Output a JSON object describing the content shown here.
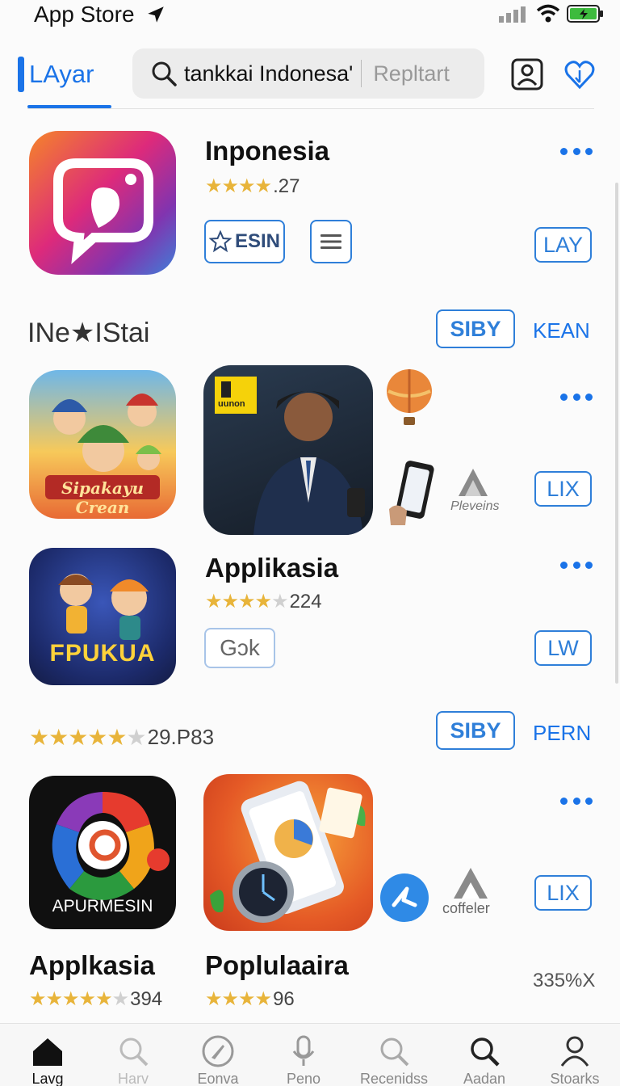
{
  "status_bar": {
    "title": "App Store"
  },
  "header": {
    "tab_label": "LAyar",
    "search_value": "tankkai Indonesa'",
    "search_action": "Repltart"
  },
  "featured": {
    "title": "Inponesia",
    "rating_value": ".27",
    "chip_label": "ESIN",
    "button": "LAY"
  },
  "section1": {
    "title": "INe★IStai",
    "button": "SIBY",
    "link": "KEAN"
  },
  "row1": {
    "game_tile_text": "Sipakayu Crean",
    "media_badge": "uunon",
    "side_logo": "Pleveins",
    "button": "LIX"
  },
  "app2": {
    "icon_text": "FPUKUA",
    "title": "Applikasia",
    "rating_value": "224",
    "chip_label": "Gɔk",
    "button": "LW"
  },
  "section2": {
    "rating_value": "29.P83",
    "button": "SIBY",
    "link": "PERN"
  },
  "row3": {
    "icon_text": "APURMESIN",
    "side_logo": "coffeler",
    "button": "LIX",
    "items": [
      {
        "title": "Applkasia",
        "rating_value": "394"
      },
      {
        "title": "Poplulaaira",
        "rating_value": "96"
      }
    ],
    "side_value": "335%X"
  },
  "tabbar": {
    "tabs": [
      {
        "label": "Lavg"
      },
      {
        "label": "Harv"
      },
      {
        "label": "Eonva"
      },
      {
        "label": "Peno"
      },
      {
        "label": "Recenidss"
      },
      {
        "label": "Aadan"
      },
      {
        "label": "Stoarks"
      }
    ]
  },
  "colors": {
    "accent": "#1a73e8",
    "star": "#e8b43a"
  }
}
